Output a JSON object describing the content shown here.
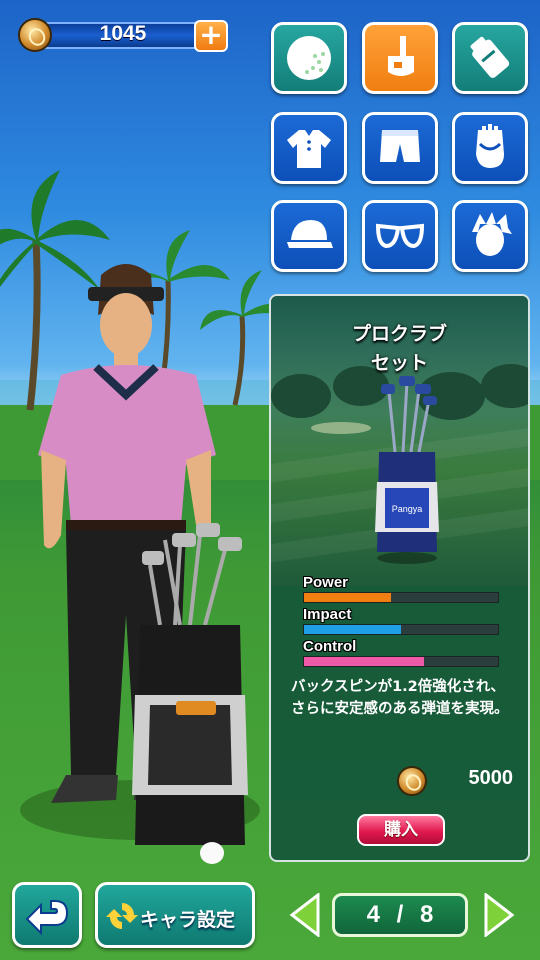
{
  "currency": {
    "coins": "1045",
    "add_label": "+"
  },
  "categories": [
    {
      "icon": "golf-ball-icon",
      "style": "teal"
    },
    {
      "icon": "driver-icon",
      "style": "orange"
    },
    {
      "icon": "bag-icon",
      "style": "teal"
    },
    {
      "icon": "shirt-icon",
      "style": "blue"
    },
    {
      "icon": "pants-icon",
      "style": "blue"
    },
    {
      "icon": "glove-icon",
      "style": "blue"
    },
    {
      "icon": "cap-icon",
      "style": "blue"
    },
    {
      "icon": "glasses-icon",
      "style": "blue"
    },
    {
      "icon": "hair-icon",
      "style": "blue"
    }
  ],
  "item": {
    "title_line1": "プロクラブ",
    "title_line2": "セット",
    "bag_logo": "Pangya",
    "stats": [
      {
        "label": "Power",
        "level": 0.45,
        "color": "#f07e10"
      },
      {
        "label": "Impact",
        "level": 0.5,
        "color": "#1fa0e6"
      },
      {
        "label": "Control",
        "level": 0.62,
        "color": "#ef5aa8"
      }
    ],
    "description": "バックスピンが1.2倍強化され、さらに安定感のある弾道を実現。",
    "price": "5000",
    "buy_label": "購入"
  },
  "footer": {
    "chara_label": "キャラ設定",
    "page_current": "4",
    "page_total": "8",
    "page_sep": "/"
  },
  "colors": {
    "accent_teal": "#21a79c",
    "accent_blue": "#1c6ad6",
    "buy_red": "#e1194f"
  }
}
